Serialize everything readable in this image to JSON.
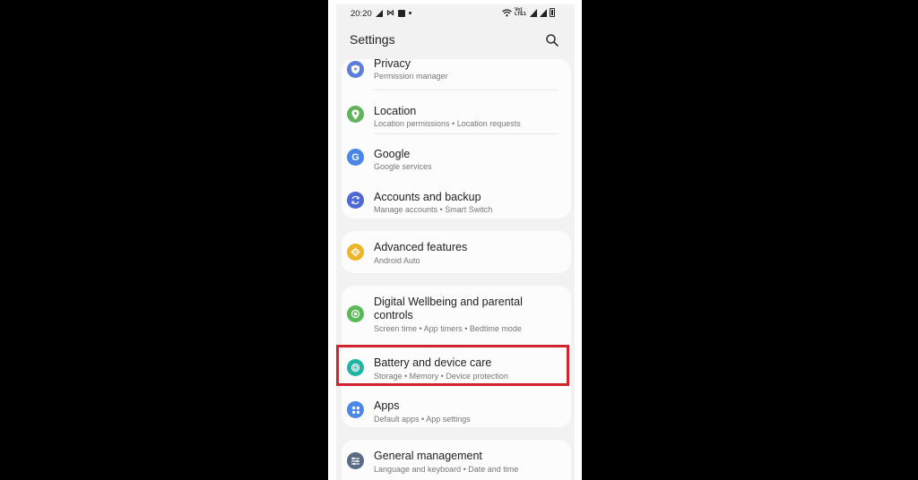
{
  "status_bar": {
    "time": "20:20",
    "left_icons": [
      "signal-boost-icon",
      "gallery-icon",
      "image-icon",
      "dot-icon"
    ],
    "right_icons": [
      "wifi-icon",
      "volte-icon",
      "signal-icon",
      "signal-icon",
      "battery-icon"
    ],
    "volte_label": "Vo) LTE1"
  },
  "header": {
    "title": "Settings",
    "search_icon": "search-icon"
  },
  "cards": [
    {
      "items": [
        {
          "label": "Privacy",
          "sub": "Permission manager",
          "icon": "privacy-shield-icon",
          "color": "#5b7ed9"
        },
        {
          "label": "Location",
          "sub": "Location permissions  •  Location requests",
          "icon": "location-pin-icon",
          "color": "#63b35d"
        },
        {
          "label": "Google",
          "sub": "Google services",
          "icon": "google-icon",
          "color": "#4a86e8"
        },
        {
          "label": "Accounts and backup",
          "sub": "Manage accounts  •  Smart Switch",
          "icon": "sync-icon",
          "color": "#4d67d6"
        }
      ]
    },
    {
      "items": [
        {
          "label": "Advanced features",
          "sub": "Android Auto",
          "icon": "gear-plus-icon",
          "color": "#f0b429"
        }
      ]
    },
    {
      "items": [
        {
          "label": "Digital Wellbeing and parental controls",
          "sub": "Screen time  •  App timers  •  Bedtime mode",
          "icon": "wellbeing-icon",
          "color": "#59b954"
        },
        {
          "label": "Battery and device care",
          "sub": "Storage  •  Memory  •  Device protection",
          "icon": "device-care-icon",
          "color": "#1fb5a4"
        },
        {
          "label": "Apps",
          "sub": "Default apps  •  App settings",
          "icon": "apps-grid-icon",
          "color": "#4a88e8"
        }
      ]
    },
    {
      "items": [
        {
          "label": "General management",
          "sub": "Language and keyboard  •  Date and time",
          "icon": "sliders-icon",
          "color": "#5a6b85"
        }
      ]
    }
  ],
  "highlight_color": "#d0252f"
}
